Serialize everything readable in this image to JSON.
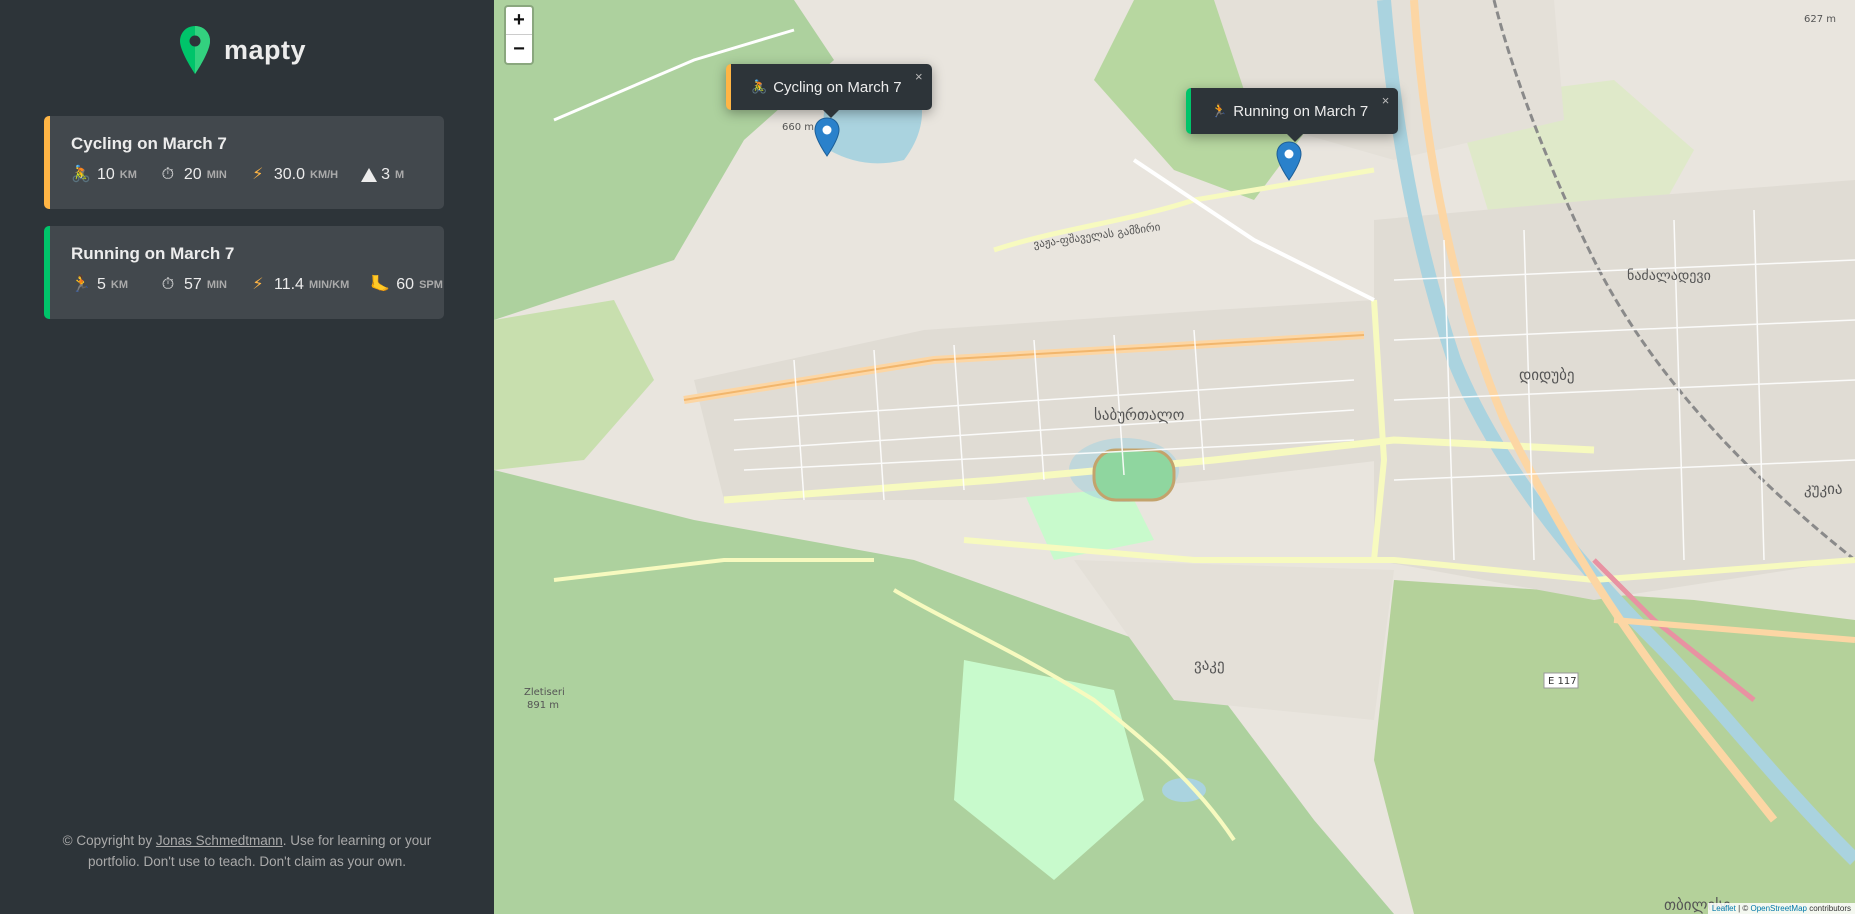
{
  "app": {
    "name": "mapty"
  },
  "workouts": [
    {
      "title": "Cycling on March 7",
      "type": "cycling",
      "distance": "10",
      "distance_unit": "km",
      "duration": "20",
      "duration_unit": "min",
      "speed": "30.0",
      "speed_unit": "km/h",
      "elev": "3",
      "elev_unit": "m",
      "icons": {
        "type": "bicycle-emoji",
        "duration": "stopwatch-emoji",
        "speed": "lightning-emoji",
        "elev": "mountain-emoji"
      }
    },
    {
      "title": "Running on March 7",
      "type": "running",
      "distance": "5",
      "distance_unit": "km",
      "duration": "57",
      "duration_unit": "min",
      "pace": "11.4",
      "pace_unit": "min/km",
      "cadence": "60",
      "cadence_unit": "spm",
      "icons": {
        "type": "runner-emoji",
        "duration": "stopwatch-emoji",
        "pace": "lightning-emoji",
        "cadence": "foot-emoji"
      }
    }
  ],
  "popups": {
    "cycling": "Cycling on March 7",
    "running": "Running on March 7",
    "close": "×"
  },
  "zoom": {
    "in": "+",
    "out": "−"
  },
  "map_labels": {
    "saburtalo": "საბურთალო",
    "vake": "ვაკე",
    "didube": "დიდუბე",
    "kukia": "კუკია",
    "tbilisi": "თბილისი",
    "elev_660": "660 m",
    "elev_627": "627 m",
    "zletiseri": "Zletiseri",
    "elev_891": "891 m",
    "e117": "E 117",
    "nadzaladevi": "ნაძალადევი",
    "vazha": "ვაჟა-ფშაველას გამზირი"
  },
  "attribution": {
    "leaflet": "Leaflet",
    "sep": " | © ",
    "osm": "OpenStreetMap",
    "rest": " contributors"
  },
  "footer": {
    "prefix": "© Copyright by ",
    "author": "Jonas Schmedtmann",
    "suffix": ". Use for learning or your portfolio. Don't use to teach. Don't claim as your own."
  },
  "colors": {
    "cycling": "#ffb545",
    "running": "#00c46a",
    "sidebar": "#2d3439",
    "card": "#42484d",
    "marker": "#2a81cb"
  }
}
